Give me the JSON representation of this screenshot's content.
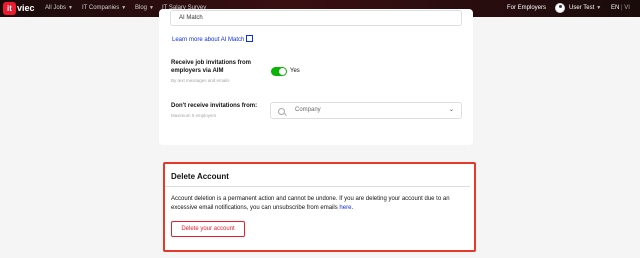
{
  "header": {
    "logo_text": "itviec",
    "nav": [
      {
        "label": "All Jobs"
      },
      {
        "label": "IT Companies"
      },
      {
        "label": "Blog"
      },
      {
        "label": "IT Salary Survey"
      }
    ],
    "for_employers": "For Employers",
    "user_name": "User Test",
    "lang_en": "EN",
    "lang_separator": "|",
    "lang_vi": "VI"
  },
  "settings": {
    "ai_match_value": "AI Match",
    "learn_more_link": "Learn more about AI Match",
    "receive_invites_label": "Receive job invitations from employers via AIM",
    "receive_invites_hint": "By text messages and emails",
    "toggle_state": "Yes",
    "dont_receive_label": "Don't receive invitations from:",
    "dont_receive_hint": "Maximum 5 employers",
    "company_placeholder": "Company"
  },
  "delete_account": {
    "title": "Delete Account",
    "description_part1": "Account deletion is a permanent action and cannot be undone. If you are deleting your account due to an excessive email notifications, you can unsubscribe from emails ",
    "here_link": "here",
    "description_end": ".",
    "button_label": "Delete your account"
  },
  "colors": {
    "brand_red": "#ed1b2f",
    "toggle_green": "#0ab305",
    "link_blue": "#0e2eed",
    "highlight_border": "#e43a2c"
  }
}
